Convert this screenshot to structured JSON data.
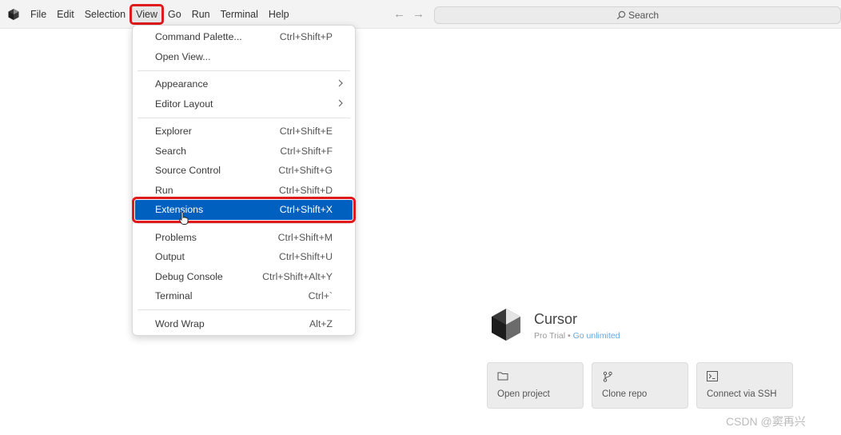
{
  "menubar": {
    "items": [
      "File",
      "Edit",
      "Selection",
      "View",
      "Go",
      "Run",
      "Terminal",
      "Help"
    ],
    "active": "View"
  },
  "search": {
    "label": "Search"
  },
  "view_menu": {
    "groups": [
      [
        {
          "label": "Command Palette...",
          "shortcut": "Ctrl+Shift+P"
        },
        {
          "label": "Open View...",
          "shortcut": ""
        }
      ],
      [
        {
          "label": "Appearance",
          "submenu": true
        },
        {
          "label": "Editor Layout",
          "submenu": true
        }
      ],
      [
        {
          "label": "Explorer",
          "shortcut": "Ctrl+Shift+E"
        },
        {
          "label": "Search",
          "shortcut": "Ctrl+Shift+F"
        },
        {
          "label": "Source Control",
          "shortcut": "Ctrl+Shift+G"
        },
        {
          "label": "Run",
          "shortcut": "Ctrl+Shift+D"
        },
        {
          "label": "Extensions",
          "shortcut": "Ctrl+Shift+X",
          "highlighted": true
        }
      ],
      [
        {
          "label": "Problems",
          "shortcut": "Ctrl+Shift+M"
        },
        {
          "label": "Output",
          "shortcut": "Ctrl+Shift+U"
        },
        {
          "label": "Debug Console",
          "shortcut": "Ctrl+Shift+Alt+Y"
        },
        {
          "label": "Terminal",
          "shortcut": "Ctrl+`"
        }
      ],
      [
        {
          "label": "Word Wrap",
          "shortcut": "Alt+Z"
        }
      ]
    ]
  },
  "welcome": {
    "app_name": "Cursor",
    "plan": "Pro Trial",
    "separator": "•",
    "upgrade_link": "Go unlimited",
    "cards": [
      {
        "label": "Open project",
        "icon": "folder-icon"
      },
      {
        "label": "Clone repo",
        "icon": "git-branch-icon"
      },
      {
        "label": "Connect via SSH",
        "icon": "terminal-icon"
      }
    ]
  },
  "watermark": "CSDN @窦再兴",
  "colors": {
    "highlight": "#0060c0",
    "annotation": "#e0191c",
    "link": "#6aa8dc"
  }
}
